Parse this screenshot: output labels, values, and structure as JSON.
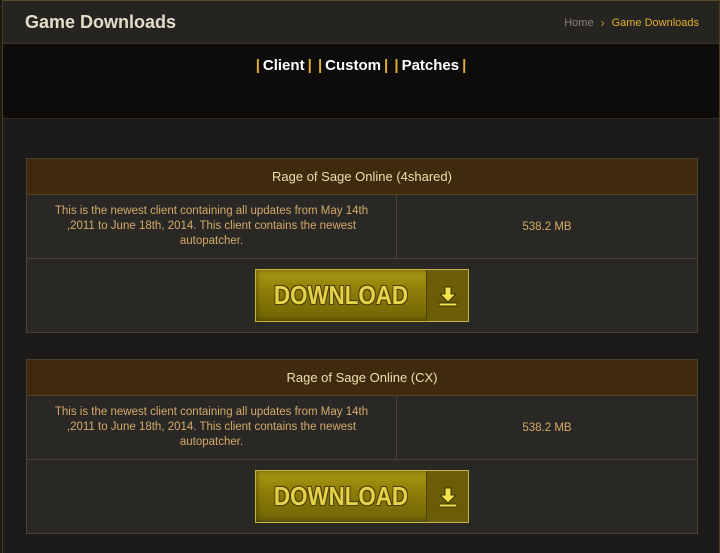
{
  "header": {
    "title": "Game Downloads",
    "breadcrumb": {
      "home": "Home",
      "separator": "›",
      "current": "Game Downloads"
    }
  },
  "nav": {
    "links": [
      "Client",
      "Custom",
      "Patches"
    ],
    "pipe": "|"
  },
  "downloads": [
    {
      "title": "Rage of Sage Online (4shared)",
      "description": "This is the newest client containing all updates from May 14th ,2011 to June 18th, 2014. This client contains the newest autopatcher.",
      "size": "538.2 MB",
      "button_label": "DOWNLOAD",
      "button_icon": "download-arrow-icon"
    },
    {
      "title": "Rage of Sage Online (CX)",
      "description": "This is the newest client containing all updates from May 14th ,2011 to June 18th, 2014. This client contains the newest autopatcher.",
      "size": "538.2 MB",
      "button_label": "DOWNLOAD",
      "button_icon": "download-arrow-icon"
    }
  ],
  "colors": {
    "accent": "#e0b030",
    "card_header": "#3f2a0e",
    "button": "#8c7c08"
  }
}
